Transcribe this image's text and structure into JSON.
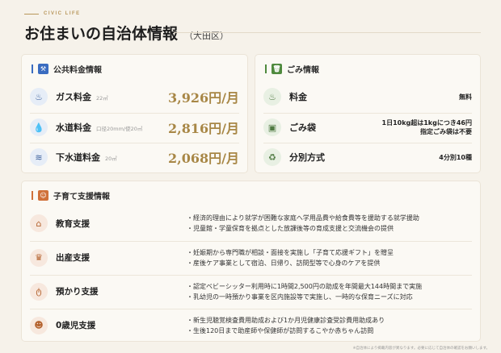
{
  "header": {
    "eyebrow": "CIVIC LIFE",
    "title": "お住まいの自治体情報",
    "area": "（大田区）"
  },
  "utilities": {
    "title": "公共料金情報",
    "items": [
      {
        "label": "ガス料金",
        "sub": "22㎥",
        "value": "3,926円/月",
        "icon": "flame-icon"
      },
      {
        "label": "水道料金",
        "sub": "口径20mm/使20㎥",
        "value": "2,816円/月",
        "icon": "water-drop-icon"
      },
      {
        "label": "下水道料金",
        "sub": "20㎥",
        "value": "2,068円/月",
        "icon": "sewer-icon"
      }
    ]
  },
  "garbage": {
    "title": "ごみ情報",
    "items": [
      {
        "label": "料金",
        "value": [
          "無料"
        ],
        "icon": "flame-icon"
      },
      {
        "label": "ごみ袋",
        "value": [
          "1日10kg超は1kgにつき46円",
          "指定ごみ袋は不要"
        ],
        "icon": "garbage-bag-icon"
      },
      {
        "label": "分別方式",
        "value": [
          "4分別10種"
        ],
        "icon": "recycle-icon"
      }
    ]
  },
  "childcare": {
    "title": "子育て支援情報",
    "items": [
      {
        "label": "教育支援",
        "icon": "school-icon",
        "lines": [
          "・経済的理由により就学が困難な家庭へ学用品費や給食費等を援助する就学援助",
          "・児童館・学童保育を拠点とした放課後等の育成支援と交流機会の提供"
        ]
      },
      {
        "label": "出産支援",
        "icon": "cake-icon",
        "lines": [
          "・妊娠期から専門職が相談・面接を実施し「子育て応援ギフト」を贈呈",
          "・産後ケア事業として宿泊、日帰り、訪問型等で心身のケアを提供"
        ]
      },
      {
        "label": "預かり支援",
        "icon": "pacifier-icon",
        "lines": [
          "・認定ベビーシッター利用時に1時間2,500円の助成を年間最大144時間まで実施",
          "・乳幼児の一時預かり事業を区内施設等で実施し、一時的な保育ニーズに対応"
        ]
      },
      {
        "label": "0歳児支援",
        "icon": "baby-icon",
        "lines": [
          "・新生児聴覚検査費用助成および1か月児健康診査受診費用助成あり",
          "・生後120日まで助産師や保健師が訪問するこやか赤ちゃん訪問"
        ]
      }
    ]
  },
  "footer": {
    "note": "※自治体により掲載内容が異なります。必要に応じて自治体の確認をお願いします。"
  },
  "colors": {
    "gold": "#a88746",
    "blue": "#3a6cc0",
    "green": "#4f8a3e",
    "orange": "#d0713a"
  }
}
